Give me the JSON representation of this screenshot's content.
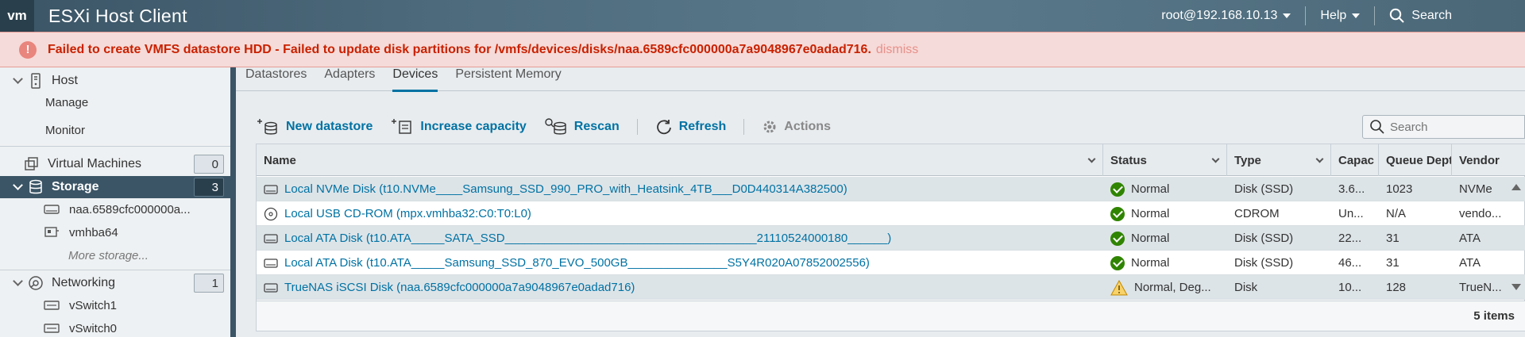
{
  "header": {
    "logo": "vm",
    "title": "ESXi Host Client",
    "user": "root@192.168.10.13",
    "help": "Help",
    "search": "Search"
  },
  "banner": {
    "message": "Failed to create VMFS datastore HDD - Failed to update disk partitions for /vmfs/devices/disks/naa.6589cfc000000a7a9048967e0adad716.",
    "dismiss": "dismiss"
  },
  "sidebar": {
    "host": "Host",
    "manage": "Manage",
    "monitor": "Monitor",
    "vms": {
      "label": "Virtual Machines",
      "count": "0"
    },
    "storage": {
      "label": "Storage",
      "count": "3"
    },
    "storage_items": [
      "naa.6589cfc000000a...",
      "vmhba64"
    ],
    "more_storage": "More storage...",
    "networking": {
      "label": "Networking",
      "count": "1"
    },
    "network_items": [
      "vSwitch1",
      "vSwitch0"
    ]
  },
  "tabs": [
    "Datastores",
    "Adapters",
    "Devices",
    "Persistent Memory"
  ],
  "active_tab": "Devices",
  "toolbar": {
    "new_datastore": "New datastore",
    "increase_capacity": "Increase capacity",
    "rescan": "Rescan",
    "refresh": "Refresh",
    "actions": "Actions",
    "search_placeholder": "Search"
  },
  "table": {
    "columns": [
      "Name",
      "Status",
      "Type",
      "Capac",
      "Queue Dept",
      "Vendor"
    ],
    "rows": [
      {
        "name": "Local NVMe Disk (t10.NVMe____Samsung_SSD_990_PRO_with_Heatsink_4TB___D0D440314A382500)",
        "icon": "disk-icon",
        "status": "Normal",
        "status_kind": "ok",
        "type": "Disk (SSD)",
        "capacity": "3.6...",
        "queue": "1023",
        "vendor": "NVMe"
      },
      {
        "name": "Local USB CD-ROM (mpx.vmhba32:C0:T0:L0)",
        "icon": "cdrom-icon",
        "status": "Normal",
        "status_kind": "ok",
        "type": "CDROM",
        "capacity": "Un...",
        "queue": "N/A",
        "vendor": "vendo..."
      },
      {
        "name": "Local ATA Disk (t10.ATA_____SATA_SSD______________________________________21110524000180______)",
        "icon": "disk-icon",
        "status": "Normal",
        "status_kind": "ok",
        "type": "Disk (SSD)",
        "capacity": "22...",
        "queue": "31",
        "vendor": "ATA"
      },
      {
        "name": "Local ATA Disk (t10.ATA_____Samsung_SSD_870_EVO_500GB_______________S5Y4R020A07852002556)",
        "icon": "disk-icon",
        "status": "Normal",
        "status_kind": "ok",
        "type": "Disk (SSD)",
        "capacity": "46...",
        "queue": "31",
        "vendor": "ATA"
      },
      {
        "name": "TrueNAS iSCSI Disk (naa.6589cfc000000a7a9048967e0adad716)",
        "icon": "disk-icon",
        "status": "Normal, Deg...",
        "status_kind": "warn",
        "type": "Disk",
        "capacity": "10...",
        "queue": "128",
        "vendor": "TrueN..."
      }
    ],
    "footer": "5 items"
  },
  "colors": {
    "accent": "#0072a3",
    "error": "#c92100",
    "ok": "#2f8400",
    "warn": "#f5b300",
    "nav_active": "#3b5566"
  }
}
